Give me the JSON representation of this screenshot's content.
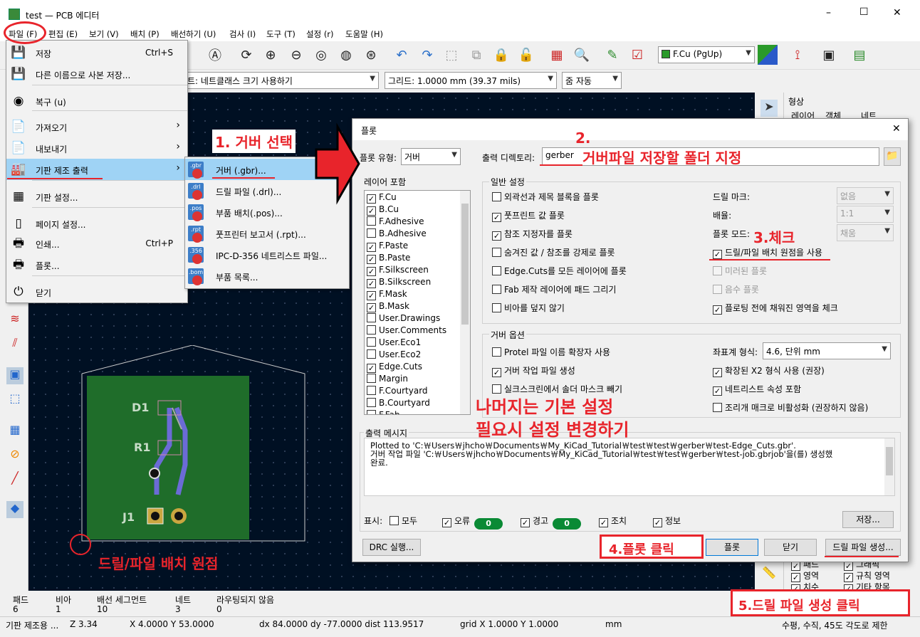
{
  "window": {
    "title": "test — PCB 에디터",
    "min": "–",
    "max": "☐",
    "close": "✕"
  },
  "menubar": [
    "파일 (F)",
    "편집 (E)",
    "보기 (V)",
    "배치 (P)",
    "배선하기 (U)",
    "검사 (I)",
    "도구 (T)",
    "설정 (r)",
    "도움말 (H)"
  ],
  "toolbar2": {
    "netclass": "트: 네트클래스 크기 사용하기",
    "grid": "그리드: 1.0000 mm (39.37 mils)",
    "zoom": "줌 자동"
  },
  "layer_select": "F.Cu (PgUp)",
  "right_panel": {
    "title": "형상",
    "tabs": [
      "레이어",
      "객체",
      "네트"
    ],
    "items_col1": [
      "패드",
      "영역",
      "치수"
    ],
    "items_col2": [
      "그래픽",
      "규칙 영역",
      "기타 항목"
    ]
  },
  "file_menu": [
    {
      "label": "저장",
      "shortcut": "Ctrl+S",
      "icon": "save-icon",
      "glyph": "💾"
    },
    {
      "label": "다른 이름으로 사본 저장...",
      "shortcut": "",
      "icon": "save-as-icon",
      "glyph": "💾"
    },
    {
      "label": "복구 (u)",
      "shortcut": "",
      "icon": "revert-icon",
      "glyph": "◉"
    },
    {
      "label": "가져오기",
      "shortcut": "",
      "icon": "import-icon",
      "glyph": "📄",
      "sub": true
    },
    {
      "label": "내보내기",
      "shortcut": "",
      "icon": "export-icon",
      "glyph": "📄",
      "sub": true
    },
    {
      "label": "기판 제조 출력",
      "shortcut": "",
      "icon": "fabrication-icon",
      "glyph": "🏭",
      "sub": true,
      "active": true
    },
    {
      "label": "기판 설정...",
      "shortcut": "",
      "icon": "board-setup-icon",
      "glyph": "▦"
    },
    {
      "label": "페이지 설정...",
      "shortcut": "",
      "icon": "page-setup-icon",
      "glyph": "▯"
    },
    {
      "label": "인쇄...",
      "shortcut": "Ctrl+P",
      "icon": "print-icon",
      "glyph": "🖶"
    },
    {
      "label": "플롯...",
      "shortcut": "",
      "icon": "plot-icon",
      "glyph": "🖶"
    },
    {
      "label": "닫기",
      "shortcut": "",
      "icon": "power-icon",
      "glyph": "⏻"
    }
  ],
  "fab_submenu": [
    {
      "label": "거버 (.gbr)...",
      "ext": ".gbr",
      "active": true
    },
    {
      "label": "드릴 파일 (.drl)...",
      "ext": ".drl"
    },
    {
      "label": "부품 배치(.pos)...",
      "ext": ".pos"
    },
    {
      "label": "풋프린터 보고서 (.rpt)...",
      "ext": ".rpt"
    },
    {
      "label": "IPC-D-356 네트리스트 파일...",
      "ext": ".356"
    },
    {
      "label": "부품 목록...",
      "ext": ".bom"
    }
  ],
  "dialog": {
    "title": "플롯",
    "plot_format_label": "플롯 유형:",
    "plot_format": "거버",
    "output_dir_label": "출력 디렉토리:",
    "output_dir": "gerber",
    "layers_label": "레이어 포함",
    "layers": [
      {
        "name": "F.Cu",
        "on": true
      },
      {
        "name": "B.Cu",
        "on": true
      },
      {
        "name": "F.Adhesive",
        "on": false
      },
      {
        "name": "B.Adhesive",
        "on": false
      },
      {
        "name": "F.Paste",
        "on": true
      },
      {
        "name": "B.Paste",
        "on": true
      },
      {
        "name": "F.Silkscreen",
        "on": true
      },
      {
        "name": "B.Silkscreen",
        "on": true
      },
      {
        "name": "F.Mask",
        "on": true
      },
      {
        "name": "B.Mask",
        "on": true
      },
      {
        "name": "User.Drawings",
        "on": false
      },
      {
        "name": "User.Comments",
        "on": false
      },
      {
        "name": "User.Eco1",
        "on": false
      },
      {
        "name": "User.Eco2",
        "on": false
      },
      {
        "name": "Edge.Cuts",
        "on": true
      },
      {
        "name": "Margin",
        "on": false
      },
      {
        "name": "F.Courtyard",
        "on": false
      },
      {
        "name": "B.Courtyard",
        "on": false
      },
      {
        "name": "F.Fab",
        "on": false
      }
    ],
    "general_label": "일반 설정",
    "general_left": [
      {
        "label": "외곽선과 제목 블록을 플롯",
        "on": false
      },
      {
        "label": "풋프린트 값 플롯",
        "on": true
      },
      {
        "label": "참조 지정자를 플롯",
        "on": true
      },
      {
        "label": "숨겨진 값 / 참조를 강제로 플롯",
        "on": false
      },
      {
        "label": "Edge.Cuts를 모든 레이어에 플롯",
        "on": false
      },
      {
        "label": "Fab 제작 레이어에 패드 그리기",
        "on": false
      },
      {
        "label": "비아를 덮지 않기",
        "on": false
      }
    ],
    "drill_marks_label": "드릴 마크:",
    "drill_marks": "없음",
    "scale_label": "배율:",
    "scale": "1:1",
    "plot_mode_label": "플롯 모드:",
    "plot_mode": "채움",
    "general_right": [
      {
        "label": "드릴/파일 배치 원점을 사용",
        "on": true,
        "dis": false
      },
      {
        "label": "미러된 플롯",
        "on": false,
        "dis": true
      },
      {
        "label": "음수 플롯",
        "on": false,
        "dis": true
      },
      {
        "label": "플로팅 전에 채워진 영역을 체크",
        "on": true,
        "dis": false
      }
    ],
    "gerber_label": "거버 옵션",
    "gerber_left": [
      {
        "label": "Protel 파일 이름 확장자 사용",
        "on": false
      },
      {
        "label": "거버 작업 파일 생성",
        "on": true
      },
      {
        "label": "실크스크린에서 솔더 마스크 빼기",
        "on": false
      }
    ],
    "coord_label": "좌표계 형식:",
    "coord": "4.6, 단위 mm",
    "gerber_right": [
      {
        "label": "확장된 X2 형식 사용 (권장)",
        "on": true
      },
      {
        "label": "네트리스트 속성 포함",
        "on": true
      },
      {
        "label": "조리개 매크로 비활성화 (권장하지 않음)",
        "on": false
      }
    ],
    "messages_label": "출력 메시지",
    "messages": [
      "Plotted to 'C:￦Users￦jhcho￦Documents￦My_KiCad_Tutorial￦test￦test￦gerber￦test-Edge_Cuts.gbr'.",
      "거버 작업 파일 'C:￦Users￦jhcho￦Documents￦My_KiCad_Tutorial￦test￦test￦gerber￦test-job.gbrjob'을(를) 생성했",
      "완료."
    ],
    "show_label": "표시:",
    "filters": {
      "all": "모두",
      "errors": "오류",
      "err_count": "0",
      "warnings": "경고",
      "warn_count": "0",
      "actions": "조치",
      "info": "정보"
    },
    "save_btn": "저장...",
    "drc_btn": "DRC 실행...",
    "plot_btn": "플롯",
    "close_btn": "닫기",
    "drill_btn": "드릴 파일 생성..."
  },
  "pcb": {
    "d1": "D1",
    "r1": "R1",
    "j1": "J1"
  },
  "annotations": {
    "step1": "1. 거버 선택",
    "step2a": "2.",
    "step2b": "거버파일 저장할 폴더 지정",
    "step3": "3.체크",
    "note1": "나머지는 기본 설정",
    "note2": "필요시 설정 변경하기",
    "step4": "4.플롯 클릭",
    "step5": "5.드릴 파일 생성 클릭",
    "origin": "드릴/파일 배치 원점"
  },
  "status": {
    "h": [
      "패드",
      "비아",
      "배선 세그먼트",
      "네트",
      "라우팅되지 않음"
    ],
    "v": [
      "6",
      "1",
      "10",
      "3",
      "0"
    ],
    "bar": [
      "기판 제조용 ...",
      "Z 3.34",
      "X 4.0000  Y 53.0000",
      "dx 84.0000  dy -77.0000  dist 113.9517",
      "grid X 1.0000  Y 1.0000",
      "mm",
      "수평, 수직, 45도 각도로 제한"
    ]
  }
}
